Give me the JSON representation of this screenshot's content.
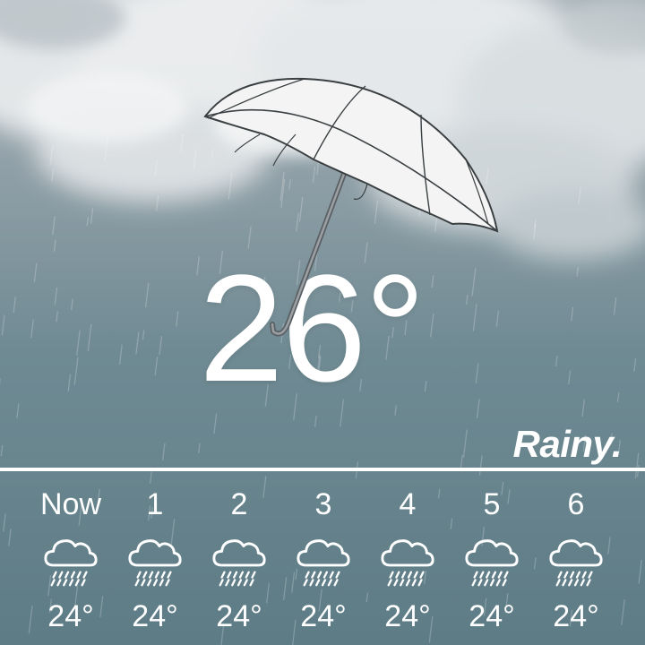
{
  "current": {
    "temperature": "26°",
    "condition": "Rainy."
  },
  "forecast": {
    "hours": [
      {
        "label": "Now",
        "icon": "rain-cloud-icon",
        "temperature": "24°"
      },
      {
        "label": "1",
        "icon": "rain-cloud-icon",
        "temperature": "24°"
      },
      {
        "label": "2",
        "icon": "rain-cloud-icon",
        "temperature": "24°"
      },
      {
        "label": "3",
        "icon": "rain-cloud-icon",
        "temperature": "24°"
      },
      {
        "label": "4",
        "icon": "rain-cloud-icon",
        "temperature": "24°"
      },
      {
        "label": "5",
        "icon": "rain-cloud-icon",
        "temperature": "24°"
      },
      {
        "label": "6",
        "icon": "rain-cloud-icon",
        "temperature": "24°"
      }
    ]
  },
  "colors": {
    "text": "#ffffff",
    "sky_top": "#a9b4ba",
    "sky_bottom": "#5e7c86",
    "umbrella": "#f4f4f4"
  },
  "background": {
    "icon": "storm-clouds-background",
    "illustration": "umbrella-icon"
  }
}
